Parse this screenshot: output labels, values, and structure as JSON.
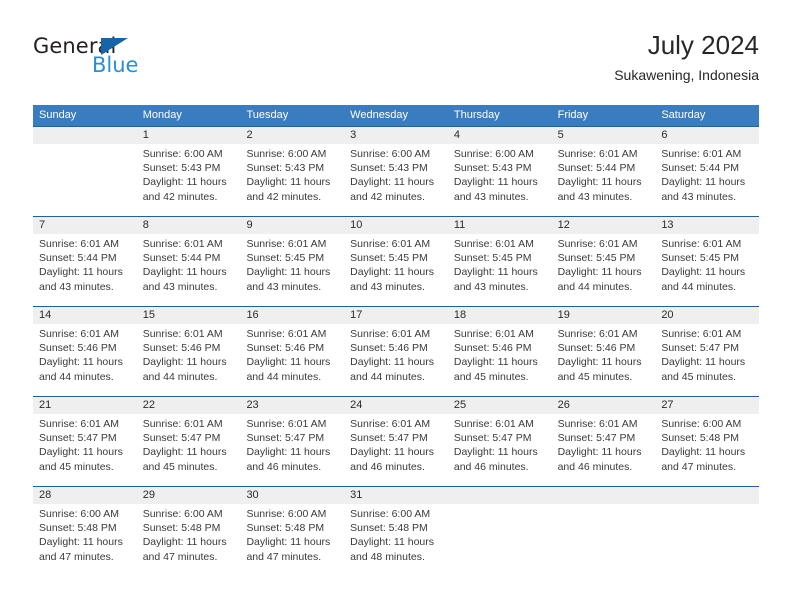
{
  "brand": {
    "line1": "General",
    "line2": "Blue",
    "triangle_color": "#1565a8",
    "blue_color": "#2b8fd4"
  },
  "header": {
    "title": "July 2024",
    "subtitle": "Sukawening, Indonesia"
  },
  "colors": {
    "header_blue": "#3a7cc0",
    "separator_blue": "#1f5fa2",
    "day_band_gray": "#efefef"
  },
  "weekdays": [
    "Sunday",
    "Monday",
    "Tuesday",
    "Wednesday",
    "Thursday",
    "Friday",
    "Saturday"
  ],
  "weeks": [
    {
      "days": [
        {
          "num": "",
          "lines": []
        },
        {
          "num": "1",
          "lines": [
            "Sunrise: 6:00 AM",
            "Sunset: 5:43 PM",
            "Daylight: 11 hours",
            "and 42 minutes."
          ]
        },
        {
          "num": "2",
          "lines": [
            "Sunrise: 6:00 AM",
            "Sunset: 5:43 PM",
            "Daylight: 11 hours",
            "and 42 minutes."
          ]
        },
        {
          "num": "3",
          "lines": [
            "Sunrise: 6:00 AM",
            "Sunset: 5:43 PM",
            "Daylight: 11 hours",
            "and 42 minutes."
          ]
        },
        {
          "num": "4",
          "lines": [
            "Sunrise: 6:00 AM",
            "Sunset: 5:43 PM",
            "Daylight: 11 hours",
            "and 43 minutes."
          ]
        },
        {
          "num": "5",
          "lines": [
            "Sunrise: 6:01 AM",
            "Sunset: 5:44 PM",
            "Daylight: 11 hours",
            "and 43 minutes."
          ]
        },
        {
          "num": "6",
          "lines": [
            "Sunrise: 6:01 AM",
            "Sunset: 5:44 PM",
            "Daylight: 11 hours",
            "and 43 minutes."
          ]
        }
      ]
    },
    {
      "days": [
        {
          "num": "7",
          "lines": [
            "Sunrise: 6:01 AM",
            "Sunset: 5:44 PM",
            "Daylight: 11 hours",
            "and 43 minutes."
          ]
        },
        {
          "num": "8",
          "lines": [
            "Sunrise: 6:01 AM",
            "Sunset: 5:44 PM",
            "Daylight: 11 hours",
            "and 43 minutes."
          ]
        },
        {
          "num": "9",
          "lines": [
            "Sunrise: 6:01 AM",
            "Sunset: 5:45 PM",
            "Daylight: 11 hours",
            "and 43 minutes."
          ]
        },
        {
          "num": "10",
          "lines": [
            "Sunrise: 6:01 AM",
            "Sunset: 5:45 PM",
            "Daylight: 11 hours",
            "and 43 minutes."
          ]
        },
        {
          "num": "11",
          "lines": [
            "Sunrise: 6:01 AM",
            "Sunset: 5:45 PM",
            "Daylight: 11 hours",
            "and 43 minutes."
          ]
        },
        {
          "num": "12",
          "lines": [
            "Sunrise: 6:01 AM",
            "Sunset: 5:45 PM",
            "Daylight: 11 hours",
            "and 44 minutes."
          ]
        },
        {
          "num": "13",
          "lines": [
            "Sunrise: 6:01 AM",
            "Sunset: 5:45 PM",
            "Daylight: 11 hours",
            "and 44 minutes."
          ]
        }
      ]
    },
    {
      "days": [
        {
          "num": "14",
          "lines": [
            "Sunrise: 6:01 AM",
            "Sunset: 5:46 PM",
            "Daylight: 11 hours",
            "and 44 minutes."
          ]
        },
        {
          "num": "15",
          "lines": [
            "Sunrise: 6:01 AM",
            "Sunset: 5:46 PM",
            "Daylight: 11 hours",
            "and 44 minutes."
          ]
        },
        {
          "num": "16",
          "lines": [
            "Sunrise: 6:01 AM",
            "Sunset: 5:46 PM",
            "Daylight: 11 hours",
            "and 44 minutes."
          ]
        },
        {
          "num": "17",
          "lines": [
            "Sunrise: 6:01 AM",
            "Sunset: 5:46 PM",
            "Daylight: 11 hours",
            "and 44 minutes."
          ]
        },
        {
          "num": "18",
          "lines": [
            "Sunrise: 6:01 AM",
            "Sunset: 5:46 PM",
            "Daylight: 11 hours",
            "and 45 minutes."
          ]
        },
        {
          "num": "19",
          "lines": [
            "Sunrise: 6:01 AM",
            "Sunset: 5:46 PM",
            "Daylight: 11 hours",
            "and 45 minutes."
          ]
        },
        {
          "num": "20",
          "lines": [
            "Sunrise: 6:01 AM",
            "Sunset: 5:47 PM",
            "Daylight: 11 hours",
            "and 45 minutes."
          ]
        }
      ]
    },
    {
      "days": [
        {
          "num": "21",
          "lines": [
            "Sunrise: 6:01 AM",
            "Sunset: 5:47 PM",
            "Daylight: 11 hours",
            "and 45 minutes."
          ]
        },
        {
          "num": "22",
          "lines": [
            "Sunrise: 6:01 AM",
            "Sunset: 5:47 PM",
            "Daylight: 11 hours",
            "and 45 minutes."
          ]
        },
        {
          "num": "23",
          "lines": [
            "Sunrise: 6:01 AM",
            "Sunset: 5:47 PM",
            "Daylight: 11 hours",
            "and 46 minutes."
          ]
        },
        {
          "num": "24",
          "lines": [
            "Sunrise: 6:01 AM",
            "Sunset: 5:47 PM",
            "Daylight: 11 hours",
            "and 46 minutes."
          ]
        },
        {
          "num": "25",
          "lines": [
            "Sunrise: 6:01 AM",
            "Sunset: 5:47 PM",
            "Daylight: 11 hours",
            "and 46 minutes."
          ]
        },
        {
          "num": "26",
          "lines": [
            "Sunrise: 6:01 AM",
            "Sunset: 5:47 PM",
            "Daylight: 11 hours",
            "and 46 minutes."
          ]
        },
        {
          "num": "27",
          "lines": [
            "Sunrise: 6:00 AM",
            "Sunset: 5:48 PM",
            "Daylight: 11 hours",
            "and 47 minutes."
          ]
        }
      ]
    },
    {
      "days": [
        {
          "num": "28",
          "lines": [
            "Sunrise: 6:00 AM",
            "Sunset: 5:48 PM",
            "Daylight: 11 hours",
            "and 47 minutes."
          ]
        },
        {
          "num": "29",
          "lines": [
            "Sunrise: 6:00 AM",
            "Sunset: 5:48 PM",
            "Daylight: 11 hours",
            "and 47 minutes."
          ]
        },
        {
          "num": "30",
          "lines": [
            "Sunrise: 6:00 AM",
            "Sunset: 5:48 PM",
            "Daylight: 11 hours",
            "and 47 minutes."
          ]
        },
        {
          "num": "31",
          "lines": [
            "Sunrise: 6:00 AM",
            "Sunset: 5:48 PM",
            "Daylight: 11 hours",
            "and 48 minutes."
          ]
        },
        {
          "num": "",
          "lines": []
        },
        {
          "num": "",
          "lines": []
        },
        {
          "num": "",
          "lines": []
        }
      ]
    }
  ]
}
